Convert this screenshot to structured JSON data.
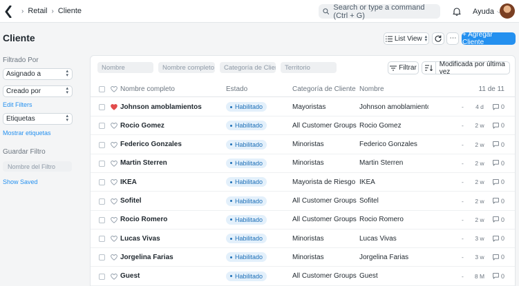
{
  "nav": {
    "breadcrumbs": [
      "Retail",
      "Cliente"
    ],
    "search_placeholder": "Search or type a command (Ctrl + G)",
    "help_label": "Ayuda"
  },
  "page": {
    "title": "Cliente",
    "view_label": "List View",
    "add_label": "+ Agregar Cliente"
  },
  "sidebar": {
    "filtered_by_label": "Filtrado Por",
    "assigned_to": "Asignado a",
    "created_by": "Creado por",
    "edit_filters": "Edit Filters",
    "tags": "Etiquetas",
    "show_tags": "Mostrar etiquetas",
    "save_filter_label": "Guardar Filtro",
    "filter_name_placeholder": "Nombre del Filtro",
    "show_saved": "Show Saved"
  },
  "filters": {
    "name_placeholder": "Nombre",
    "full_name_placeholder": "Nombre completo",
    "category_placeholder": "Categoría de Client",
    "territory_placeholder": "Territorio",
    "filter_label": "Filtrar",
    "sort_label": "Modificada por última vez"
  },
  "table": {
    "headers": {
      "full_name": "Nombre completo",
      "status": "Estado",
      "category": "Categoría de Cliente",
      "name": "Nombre",
      "count": "11 de 11"
    },
    "rows": [
      {
        "full_name": "Johnson amoblamientos",
        "status": "Habilitado",
        "category": "Mayoristas",
        "name": "Johnson amoblamiento...",
        "dash": "-",
        "time": "4 d",
        "comments": "0",
        "liked": true
      },
      {
        "full_name": "Rocio Gomez",
        "status": "Habilitado",
        "category": "All Customer Groups",
        "name": "Rocio Gomez",
        "dash": "-",
        "time": "2 w",
        "comments": "0",
        "liked": false
      },
      {
        "full_name": "Federico Gonzales",
        "status": "Habilitado",
        "category": "Minoristas",
        "name": "Federico Gonzales",
        "dash": "-",
        "time": "2 w",
        "comments": "0",
        "liked": false
      },
      {
        "full_name": "Martin Sterren",
        "status": "Habilitado",
        "category": "Minoristas",
        "name": "Martin Sterren",
        "dash": "-",
        "time": "2 w",
        "comments": "0",
        "liked": false
      },
      {
        "full_name": "IKEA",
        "status": "Habilitado",
        "category": "Mayorista de Riesgo",
        "name": "IKEA",
        "dash": "-",
        "time": "2 w",
        "comments": "0",
        "liked": false
      },
      {
        "full_name": "Sofitel",
        "status": "Habilitado",
        "category": "All Customer Groups",
        "name": "Sofitel",
        "dash": "-",
        "time": "2 w",
        "comments": "0",
        "liked": false
      },
      {
        "full_name": "Rocio Romero",
        "status": "Habilitado",
        "category": "All Customer Groups",
        "name": "Rocio Romero",
        "dash": "-",
        "time": "2 w",
        "comments": "0",
        "liked": false
      },
      {
        "full_name": "Lucas Vivas",
        "status": "Habilitado",
        "category": "Minoristas",
        "name": "Lucas Vivas",
        "dash": "-",
        "time": "3 w",
        "comments": "0",
        "liked": false
      },
      {
        "full_name": "Jorgelina Farias",
        "status": "Habilitado",
        "category": "Minoristas",
        "name": "Jorgelina Farias",
        "dash": "-",
        "time": "3 w",
        "comments": "0",
        "liked": false
      },
      {
        "full_name": "Guest",
        "status": "Habilitado",
        "category": "All Customer Groups",
        "name": "Guest",
        "dash": "-",
        "time": "8 M",
        "comments": "0",
        "liked": false
      }
    ]
  },
  "colors": {
    "primary": "#2490ef",
    "liked_heart": "#e24c4c",
    "badge_bg": "#e3f0fb",
    "badge_text": "#1d6fb7"
  }
}
